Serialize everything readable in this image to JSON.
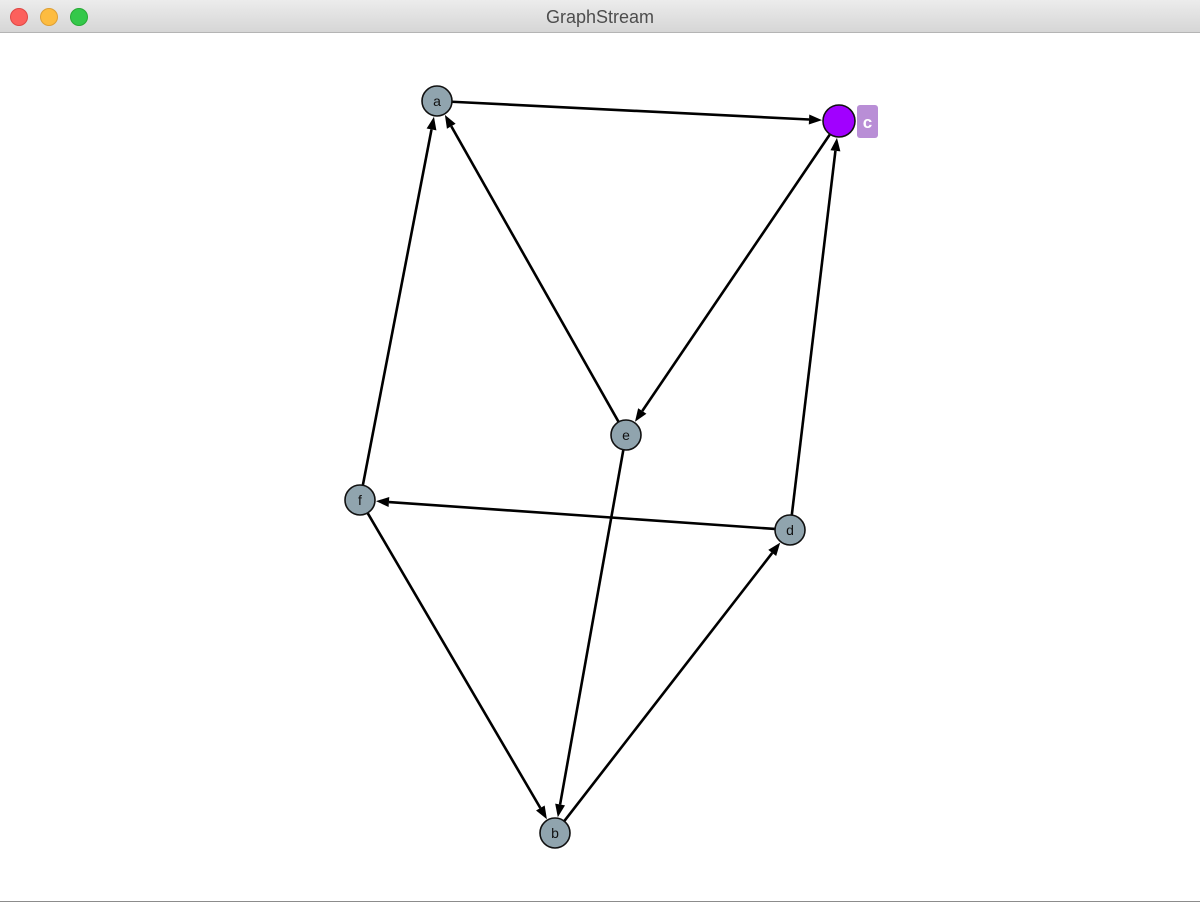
{
  "window": {
    "title": "GraphStream",
    "controls": {
      "close": "close",
      "minimize": "minimize",
      "maximize": "maximize"
    }
  },
  "graph": {
    "colors": {
      "node_fill": "#90a4ae",
      "selected_fill": "#a100ff",
      "badge_fill": "#b98ed6",
      "edge": "#000000"
    },
    "nodes": [
      {
        "id": "a",
        "label": "a"
      },
      {
        "id": "b",
        "label": "b"
      },
      {
        "id": "c",
        "label": "c",
        "selected": true
      },
      {
        "id": "d",
        "label": "d"
      },
      {
        "id": "e",
        "label": "e"
      },
      {
        "id": "f",
        "label": "f"
      }
    ],
    "edges": [
      {
        "from": "a",
        "to": "c"
      },
      {
        "from": "c",
        "to": "e"
      },
      {
        "from": "e",
        "to": "a"
      },
      {
        "from": "f",
        "to": "a"
      },
      {
        "from": "d",
        "to": "c"
      },
      {
        "from": "d",
        "to": "f"
      },
      {
        "from": "f",
        "to": "b"
      },
      {
        "from": "e",
        "to": "b"
      },
      {
        "from": "b",
        "to": "d"
      }
    ]
  }
}
